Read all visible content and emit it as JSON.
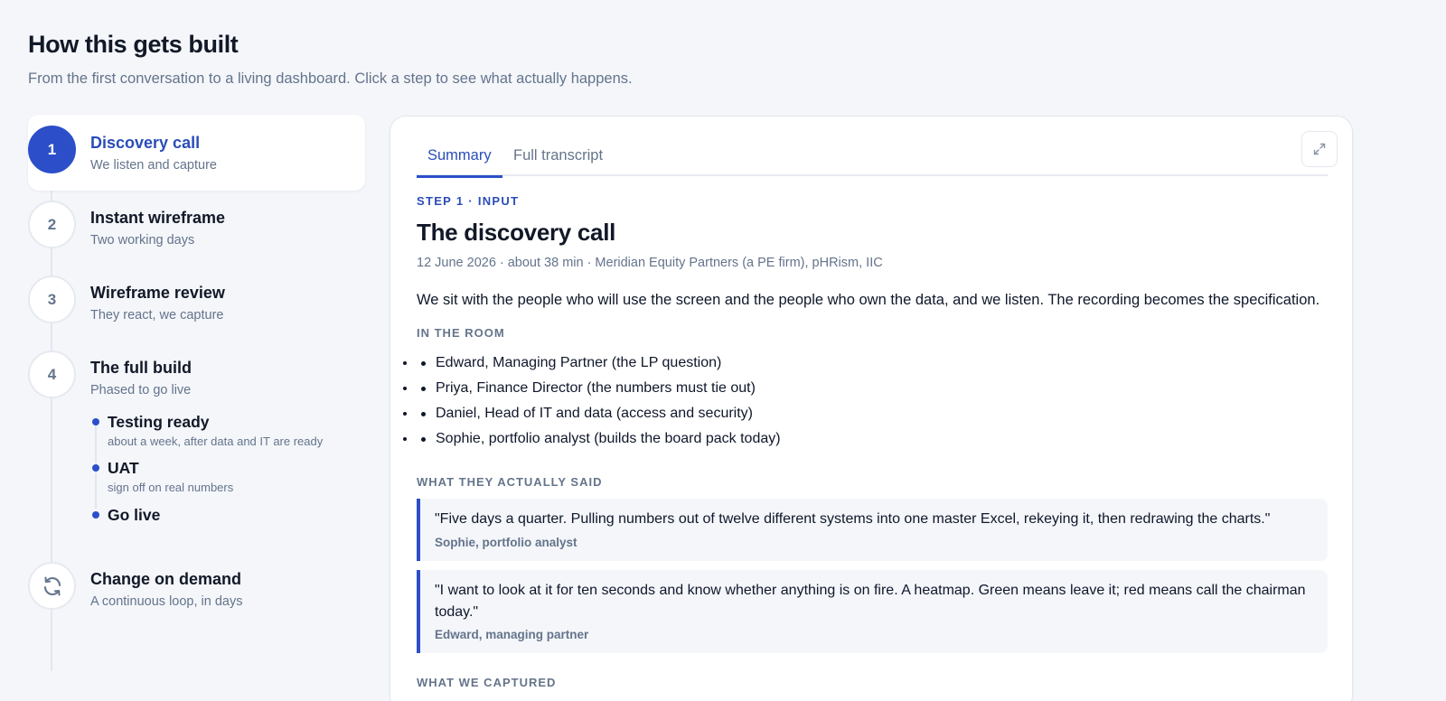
{
  "header": {
    "title": "How this gets built",
    "subtitle": "From the first conversation to a living dashboard. Click a step to see what actually happens."
  },
  "steps": [
    {
      "number": "1",
      "title": "Discovery call",
      "desc": "We listen and capture",
      "active": true
    },
    {
      "number": "2",
      "title": "Instant wireframe",
      "desc": "Two working days"
    },
    {
      "number": "3",
      "title": "Wireframe review",
      "desc": "They react, we capture"
    },
    {
      "number": "4",
      "title": "The full build",
      "desc": "Phased to go live"
    },
    {
      "number": "",
      "icon": "refresh-icon",
      "title": "Change on demand",
      "desc": "A continuous loop, in days"
    }
  ],
  "substeps": [
    {
      "title": "Testing ready",
      "desc": "about a week, after data and IT are ready"
    },
    {
      "title": "UAT",
      "desc": "sign off on real numbers"
    },
    {
      "title": "Go live",
      "desc": ""
    }
  ],
  "detail": {
    "tabs": [
      "Summary",
      "Full transcript"
    ],
    "active_tab": "Summary",
    "expand_icon": "expand-icon",
    "eyebrow": "STEP 1 · INPUT",
    "title": "The discovery call",
    "meta": [
      "12 June 2026",
      "about 38 min",
      "Meridian Equity Partners (a PE firm), pHRism, IIC"
    ],
    "lead": "We sit with the people who will use the screen and the people who own the data, and we listen. The recording becomes the specification.",
    "in_the_room_label": "IN THE ROOM",
    "attendees": [
      "Edward, Managing Partner (the LP question)",
      "Priya, Finance Director (the numbers must tie out)",
      "Daniel, Head of IT and data (access and security)",
      "Sophie, portfolio analyst (builds the board pack today)"
    ],
    "quotes_label": "WHAT THEY ACTUALLY SAID",
    "quotes": [
      {
        "text": "\"Five days a quarter. Pulling numbers out of twelve different systems into one master Excel, rekeying it, then redrawing the charts.\"",
        "author": "Sophie, portfolio analyst"
      },
      {
        "text": "\"I want to look at it for ten seconds and know whether anything is on fire. A heatmap. Green means leave it; red means call the chairman today.\"",
        "author": "Edward, managing partner"
      }
    ],
    "captured_label": "WHAT WE CAPTURED"
  },
  "colors": {
    "accent": "#2c4fc9",
    "accent_text": "#2b4db8",
    "muted": "#64748b",
    "background": "#f4f6fa"
  }
}
